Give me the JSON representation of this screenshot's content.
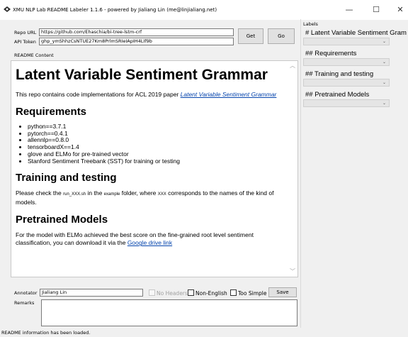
{
  "window": {
    "title": "XMU NLP Lab README Labeler 1.1.6 - powered by Jialiang Lin (me@linjialiang.net)",
    "minimize_glyph": "—",
    "maximize_glyph": "☐",
    "close_glyph": "✕"
  },
  "repo": {
    "url_label": "Repo URL",
    "url_value": "https://github.com/Ehaschia/bi-tree-lstm-crf",
    "token_label": "API Token",
    "token_value": "ghp_ymShhzCsNTUE27Km8PrlmSRIeIApIH4LIf9b",
    "get_button": "Get",
    "go_button": "Go"
  },
  "readme": {
    "section_label": "README Content",
    "h1": "Latent Variable Sentiment Grammar",
    "intro_text": "This repo contains code implementations for ACL 2019 paper ",
    "intro_link": "Latent Variable Sentiment Grammar",
    "requirements_heading": "Requirements",
    "requirements": [
      "python==3.7.1",
      "pytorch==0.4.1",
      "allennlp==0.8.0",
      "tensorboardX==1.4",
      "glove and ELMo for pre-trained vector",
      "Stanford Sentiment Treebank (SST) for training or testing"
    ],
    "training_heading": "Training and testing",
    "training_text_1": "Please check the ",
    "training_code_1": "run_XXX.sh",
    "training_text_2": " in the ",
    "training_code_2": "example",
    "training_text_3": " folder, where ",
    "training_code_3": "XXX",
    "training_text_4": " corresponds to the names of the kind of models.",
    "pretrained_heading": "Pretrained Models",
    "pretrained_text": "For the model with ELMo achieved the best score on the fine-grained root level sentiment classification, you can download it via the ",
    "pretrained_link": "Google drive link"
  },
  "labels": {
    "title": "Labels",
    "groups": [
      {
        "header": "# Latent Variable Sentiment Gram",
        "value": ""
      },
      {
        "header": "## Requirements",
        "value": ""
      },
      {
        "header": "## Training and testing",
        "value": ""
      },
      {
        "header": "## Pretrained Models",
        "value": ""
      }
    ]
  },
  "annotation": {
    "annotator_label": "Annotator",
    "annotator_value": "Jialiang Lin",
    "no_headers_label": "No Headers",
    "no_headers_checked": false,
    "non_english_label": "Non-English",
    "non_english_checked": false,
    "too_simple_label": "Too Simple",
    "too_simple_checked": false,
    "save_button": "Save",
    "remarks_label": "Remarks",
    "remarks_value": ""
  },
  "status": {
    "text": "README information has been loaded."
  }
}
